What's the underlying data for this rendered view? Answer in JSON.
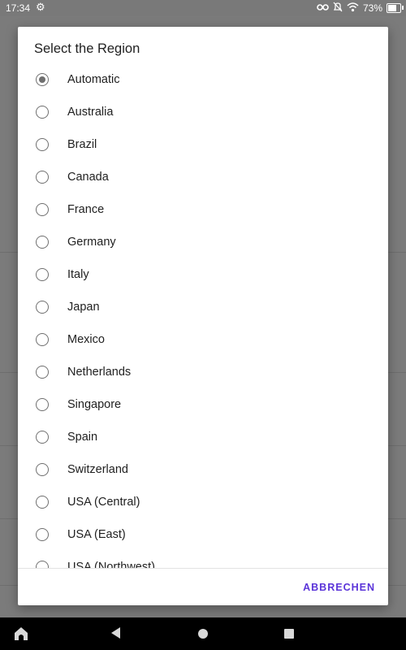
{
  "status_bar": {
    "time": "17:34",
    "battery": "73%",
    "battery_level": 0.73,
    "icons": [
      "settings-gear-icon",
      "vpn-key-icon",
      "notifications-off-icon",
      "wifi-icon",
      "battery-charging-icon"
    ]
  },
  "dialog": {
    "title": "Select the Region",
    "selected": "Automatic",
    "options": [
      "Automatic",
      "Australia",
      "Brazil",
      "Canada",
      "France",
      "Germany",
      "Italy",
      "Japan",
      "Mexico",
      "Netherlands",
      "Singapore",
      "Spain",
      "Switzerland",
      "USA (Central)",
      "USA (East)",
      "USA (Northwest)"
    ],
    "cancel_label": "ABBRECHEN"
  },
  "nav_bar": {
    "buttons": [
      "home-app-icon",
      "back-icon",
      "home-icon",
      "recents-icon"
    ]
  },
  "colors": {
    "accent": "#5b34d9",
    "radio": "#6f6f6f",
    "scrim": "#777777"
  }
}
